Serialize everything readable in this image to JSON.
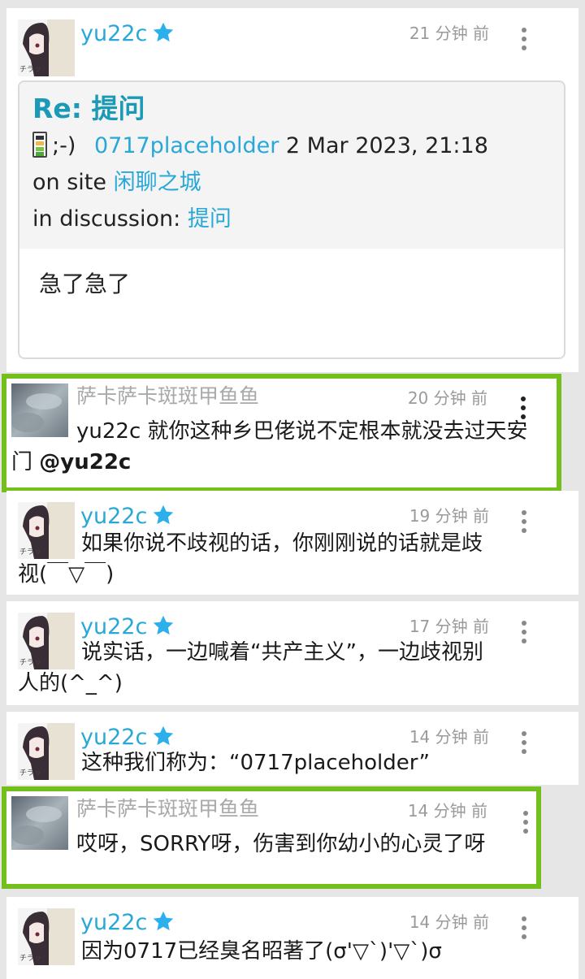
{
  "posts": [
    {
      "author": "yu22c",
      "time": "21 分钟 前",
      "quote": {
        "title": "Re: 提问",
        "emote": ";-)",
        "user": "0717placeholder",
        "date": "2 Mar 2023, 21:18",
        "site_prefix": "on site",
        "site": "闲聊之城",
        "discussion_prefix": "in discussion:",
        "discussion": "提问",
        "body": "急了急了"
      }
    },
    {
      "author": "萨卡萨卡斑斑甲鱼鱼",
      "time": "20 分钟 前",
      "text": "yu22c 就你这种乡巴佬说不定根本就没去过天安门 ",
      "mention": "@yu22c"
    },
    {
      "author": "yu22c",
      "time": "19 分钟 前",
      "text": "如果你说不歧视的话，你刚刚说的话就是歧视(￣▽￣)"
    },
    {
      "author": "yu22c",
      "time": "17 分钟 前",
      "text": "说实话，一边喊着“共产主义”，一边歧视别人的(^_^)"
    },
    {
      "author": "yu22c",
      "time": "14 分钟 前",
      "text": "这种我们称为：“0717placeholder”"
    },
    {
      "author": "萨卡萨卡斑斑甲鱼鱼",
      "time": "14 分钟 前",
      "text": "哎呀，SORRY呀，伤害到你幼小的心灵了呀"
    },
    {
      "author": "yu22c",
      "time": "14 分钟 前",
      "text": "因为0717已经臭名昭著了(σ'▽`)'▽`)σ"
    }
  ],
  "colors": {
    "username": "#29a8d8",
    "highlight_border": "#73c01c",
    "quote_title": "#1b9ab8",
    "star": "#2bb0ec"
  },
  "icons": [
    "anime-avatar",
    "star-icon",
    "kebab-menu-icon",
    "battery-icon",
    "cloudy-sky-avatar"
  ]
}
